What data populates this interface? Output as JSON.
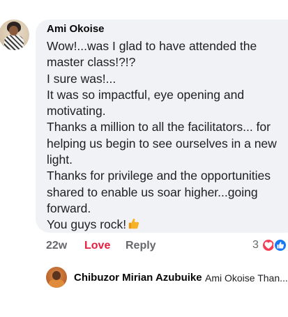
{
  "comment": {
    "author": "Ami Okoise",
    "lines": [
      "Wow!...was I glad to have attended the",
      "master class!?!?",
      "I sure was!...",
      "It was so impactful, eye opening and",
      "motivating.",
      "Thanks a million to all the facilitators... for",
      "helping us begin to see ourselves in a new",
      "light.",
      "Thanks for privilege and the opportunities",
      "shared to enable us soar higher...going",
      "forward.",
      "You guys rock!"
    ],
    "emoji": "thumbs-up-emoji",
    "time": "22w",
    "love_label": "Love",
    "reply_label": "Reply",
    "reaction_count": "3",
    "reaction_icons": [
      "heart-reaction-icon",
      "like-reaction-icon"
    ],
    "colors": {
      "bubble": "#f0f2f5",
      "love": "#e41e3f",
      "heart": "#f33e58",
      "like": "#1877f2"
    }
  },
  "reply": {
    "author": "Chibuzor Mirian Azubuike",
    "preview": "Ami Okoise Than..."
  }
}
